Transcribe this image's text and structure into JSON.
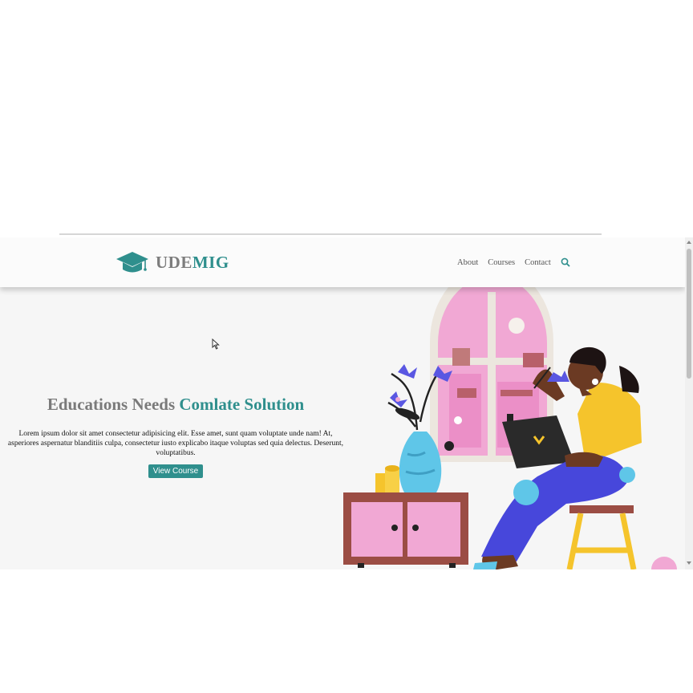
{
  "brand": {
    "name_part1": "UDE",
    "name_part2": "MIG",
    "icon": "graduation-cap-icon",
    "color": "#2f8f8d"
  },
  "nav": {
    "items": [
      {
        "label": "About"
      },
      {
        "label": "Courses"
      },
      {
        "label": "Contact"
      }
    ],
    "search_icon": "search-icon"
  },
  "hero": {
    "title_part1": "Educations Needs ",
    "title_part2": "Comlate Solution",
    "description": "Lorem ipsum dolor sit amet consectetur adipisicing elit. Esse amet, sunt quam voluptate unde nam! At, asperiores aspernatur blanditiis culpa, consectetur iusto explicabo itaque voluptas sed quia delectus. Deserunt, voluptatibus.",
    "button_label": "View Course"
  },
  "illustration": {
    "icon": "woman-with-laptop-illustration"
  },
  "colors": {
    "accent": "#2f8f8d",
    "title_gray": "#7a7a7a",
    "background": "#f6f6f6"
  }
}
